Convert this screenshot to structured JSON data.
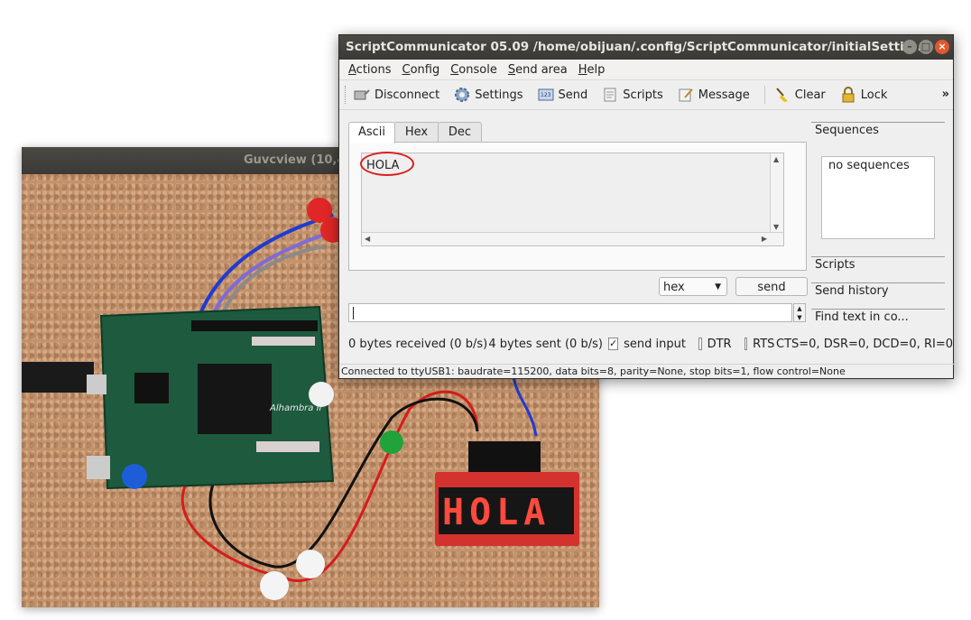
{
  "guvcview": {
    "title": "Guvcview   (10,4"
  },
  "video": {
    "display_text": "HOLA",
    "board_label": "Alhambra II"
  },
  "window": {
    "title": "ScriptCommunicator 05.09   /home/obijuan/.config/ScriptCommunicator/initialSettin..."
  },
  "menu": [
    {
      "label": "Actions",
      "accel": "A",
      "rest": "ctions"
    },
    {
      "label": "Config",
      "accel": "C",
      "rest": "onfig"
    },
    {
      "label": "Console",
      "accel": "C",
      "rest": "onsole"
    },
    {
      "label": "Send area",
      "accel": "S",
      "rest": "end area"
    },
    {
      "label": "Help",
      "accel": "H",
      "rest": "elp"
    }
  ],
  "toolbar": {
    "disconnect": "Disconnect",
    "settings": "Settings",
    "send": "Send",
    "scripts": "Scripts",
    "message": "Message",
    "clear": "Clear",
    "lock": "Lock",
    "more": "»"
  },
  "tabs": {
    "ascii": "Ascii",
    "hex": "Hex",
    "dec": "Dec"
  },
  "receive": {
    "text": "HOLA"
  },
  "side_panel": {
    "sequences": "Sequences",
    "no_sequences": "no sequences",
    "scripts": "Scripts",
    "send_history": "Send history",
    "find_text": "Find text in co..."
  },
  "send_controls": {
    "format": "hex",
    "send_button": "send",
    "input_value": ""
  },
  "status": {
    "received": "0 bytes received (0 b/s)",
    "sent": "4 bytes sent (0 b/s)",
    "send_input_label": "send input",
    "send_input_checked": true,
    "dtr_label": "DTR",
    "rts_label": "RTS",
    "lines": "CTS=0, DSR=0, DCD=0, RI=0"
  },
  "statusbar": {
    "text": "Connected to ttyUSB1: baudrate=115200, data bits=8, parity=None, stop bits=1, flow control=None"
  },
  "colors": {
    "annotation_red": "#d9201f",
    "titlebar": "#3b3a36",
    "close_button": "#e0582f",
    "display_segment": "#ff4a3d",
    "pcb": "#1d5a3e"
  }
}
